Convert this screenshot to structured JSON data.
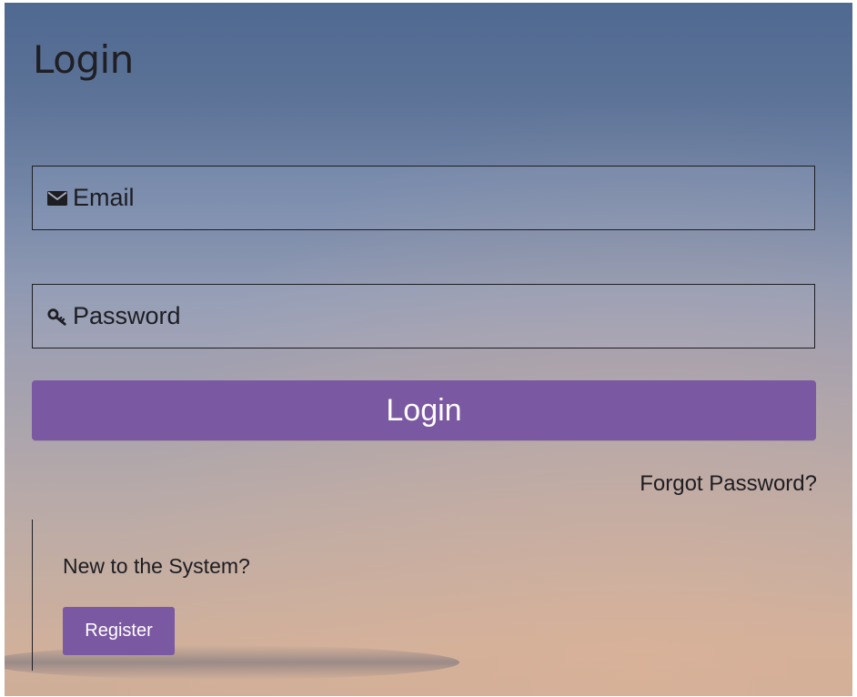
{
  "page": {
    "title": "Login"
  },
  "form": {
    "email": {
      "icon": "envelope-icon",
      "placeholder": "Email",
      "value": ""
    },
    "password": {
      "icon": "key-icon",
      "placeholder": "Password",
      "value": ""
    },
    "login_label": "Login",
    "forgot_label": "Forgot Password?"
  },
  "register": {
    "prompt": "New to the System?",
    "button_label": "Register"
  },
  "colors": {
    "accent": "#7a58a2",
    "sky_top": "#4f6991",
    "sky_bottom": "#d0b09b",
    "text": "#1d1d22"
  }
}
